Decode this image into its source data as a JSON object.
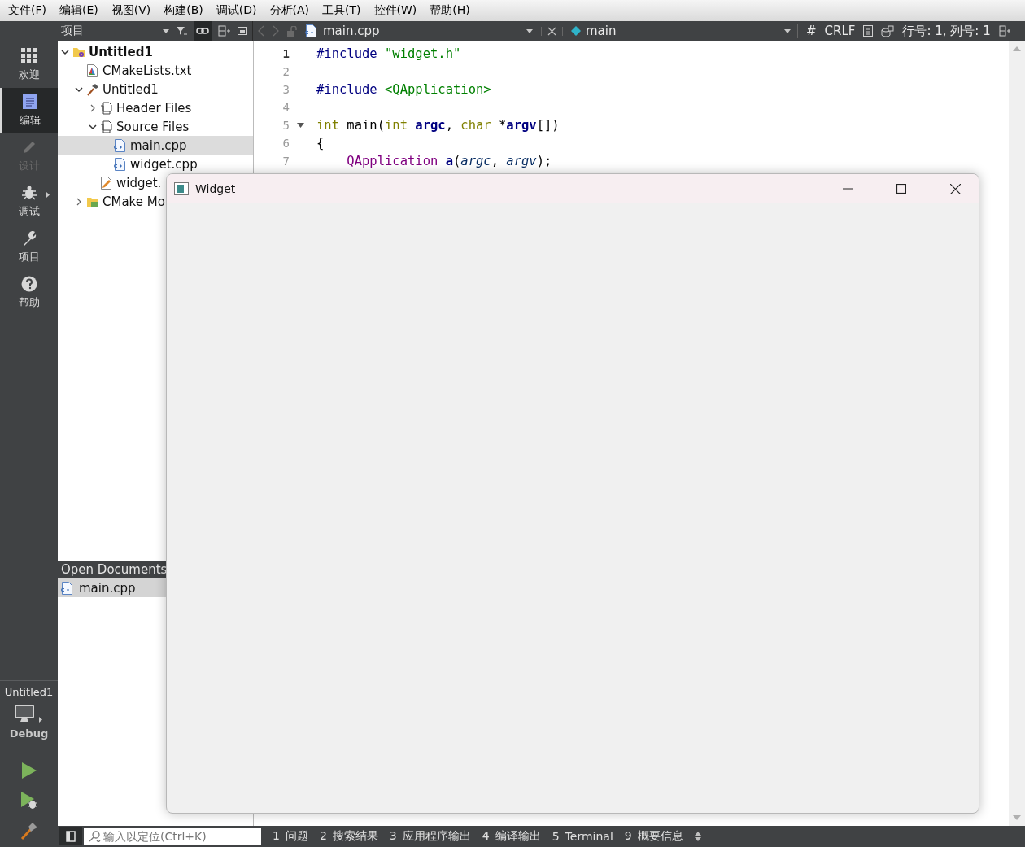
{
  "menu": [
    "文件(F)",
    "编辑(E)",
    "视图(V)",
    "构建(B)",
    "调试(D)",
    "分析(A)",
    "工具(T)",
    "控件(W)",
    "帮助(H)"
  ],
  "mode_bar": {
    "modes": [
      {
        "label": "欢迎",
        "kind": "welcome",
        "selected": false,
        "disabled": false,
        "has_menu": false
      },
      {
        "label": "编辑",
        "kind": "edit",
        "selected": true,
        "disabled": false,
        "has_menu": false
      },
      {
        "label": "设计",
        "kind": "design",
        "selected": false,
        "disabled": true,
        "has_menu": false
      },
      {
        "label": "调试",
        "kind": "debug",
        "selected": false,
        "disabled": false,
        "has_menu": true
      },
      {
        "label": "项目",
        "kind": "projects",
        "selected": false,
        "disabled": false,
        "has_menu": false
      },
      {
        "label": "帮助",
        "kind": "help",
        "selected": false,
        "disabled": false,
        "has_menu": false
      }
    ],
    "kit": {
      "project": "Untitled1",
      "build": "Debug"
    }
  },
  "project_panel": {
    "title": "项目",
    "tree": [
      {
        "label": "Untitled1",
        "kind": "project",
        "expanded": true,
        "selected": false,
        "children": [
          {
            "label": "CMakeLists.txt",
            "kind": "cmake",
            "selected": false
          },
          {
            "label": "Untitled1",
            "kind": "target",
            "expanded": true,
            "selected": false,
            "children": [
              {
                "label": "Header Files",
                "kind": "group",
                "expanded": false,
                "selected": false
              },
              {
                "label": "Source Files",
                "kind": "group",
                "expanded": true,
                "selected": false,
                "children": [
                  {
                    "label": "main.cpp",
                    "kind": "cpp",
                    "selected": true
                  },
                  {
                    "label": "widget.cpp",
                    "kind": "cpp",
                    "selected": false
                  }
                ]
              },
              {
                "label": "widget.",
                "kind": "ui",
                "selected": false
              }
            ]
          },
          {
            "label": "CMake Mo",
            "kind": "modules",
            "expanded": false,
            "selected": false
          }
        ]
      }
    ]
  },
  "open_documents": {
    "title": "Open Documents",
    "items": [
      {
        "label": "main.cpp",
        "selected": true
      }
    ]
  },
  "editor": {
    "file": "main.cpp",
    "symbol": "main",
    "indent_marker": "#",
    "line_ending": "CRLF",
    "position": "行号: 1, 列号: 1",
    "lines": [
      {
        "number": "1",
        "current": true,
        "fold": false,
        "tokens": [
          {
            "text": "#include ",
            "kind": "preproc"
          },
          {
            "text": "\"widget.h\"",
            "kind": "string"
          }
        ]
      },
      {
        "number": "2",
        "current": false,
        "fold": false
      },
      {
        "number": "3",
        "current": false,
        "fold": false,
        "tokens": [
          {
            "text": "#include ",
            "kind": "preproc"
          },
          {
            "text": "<QApplication>",
            "kind": "string"
          }
        ]
      },
      {
        "number": "4",
        "current": false,
        "fold": false
      },
      {
        "number": "5",
        "current": false,
        "fold": true,
        "tokens": [
          {
            "text": "int",
            "kind": "keyword"
          },
          {
            "text": " main(",
            "kind": "plain"
          },
          {
            "text": "int",
            "kind": "keyword"
          },
          {
            "text": " argc",
            "kind": "bold"
          },
          {
            "text": ", ",
            "kind": "plain"
          },
          {
            "text": "char",
            "kind": "keyword"
          },
          {
            "text": " *",
            "kind": "plain"
          },
          {
            "text": "argv",
            "kind": "bold"
          },
          {
            "text": "[])",
            "kind": "plain"
          }
        ]
      },
      {
        "number": "6",
        "current": false,
        "fold": false,
        "tokens": [
          {
            "text": "{",
            "kind": "plain"
          }
        ]
      },
      {
        "number": "7",
        "current": false,
        "fold": false,
        "tokens": [
          {
            "text": "    QApplication",
            "kind": "type"
          },
          {
            "text": " a",
            "kind": "bold"
          },
          {
            "text": "(",
            "kind": "plain"
          },
          {
            "text": "argc",
            "kind": "param"
          },
          {
            "text": ", ",
            "kind": "plain"
          },
          {
            "text": "argv",
            "kind": "param"
          },
          {
            "text": ");",
            "kind": "plain"
          }
        ]
      }
    ]
  },
  "output_bar": {
    "locator": {
      "placeholder": "输入以定位(Ctrl+K)"
    },
    "tabs": [
      {
        "number": "1",
        "label": "问题"
      },
      {
        "number": "2",
        "label": "搜索结果"
      },
      {
        "number": "3",
        "label": "应用程序输出"
      },
      {
        "number": "4",
        "label": "编译输出"
      },
      {
        "number": "5",
        "label": "Terminal"
      },
      {
        "number": "9",
        "label": "概要信息"
      }
    ]
  },
  "window": {
    "title": "Widget"
  }
}
